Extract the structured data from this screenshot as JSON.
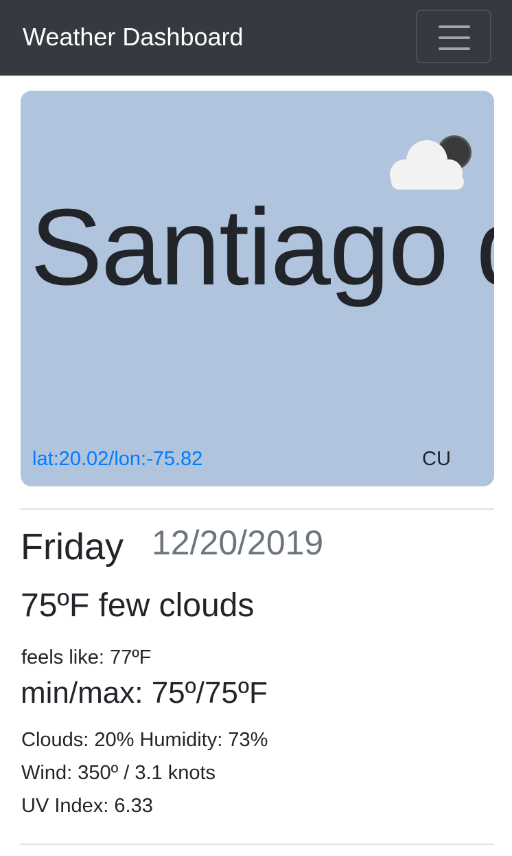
{
  "navbar": {
    "brand": "Weather Dashboard",
    "toggler_icon": "hamburger-menu-icon"
  },
  "location": {
    "city": "Santiago de Cuba",
    "coordinates": "lat:20.02/lon:-75.82",
    "country": "CU",
    "weather_icon": "few-clouds-night-icon"
  },
  "forecast": {
    "day": "Friday",
    "date": "12/20/2019",
    "temp_desc": "75ºF few clouds",
    "feels_like": "feels like: 77ºF",
    "min_max": "min/max: 75º/75ºF",
    "clouds_humidity": "Clouds: 20%  Humidity: 73%",
    "wind": "Wind: 350º / 3.1 knots",
    "uv_index": "UV Index: 6.33"
  },
  "colors": {
    "navbar_bg": "#343a40",
    "card_bg": "#b0c4de",
    "link": "#007bff",
    "muted": "#6c757d"
  }
}
